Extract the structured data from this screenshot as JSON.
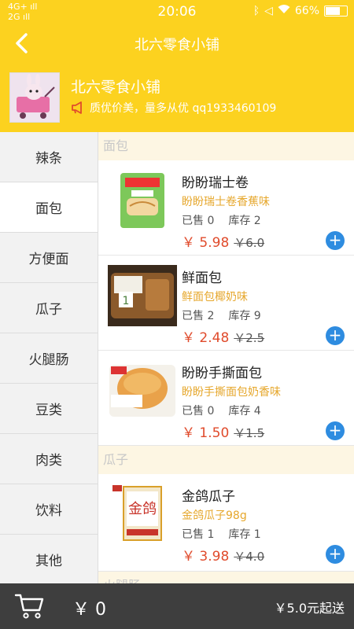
{
  "status_bar": {
    "network_1": "4G+",
    "network_2": "2G",
    "time": "20:06",
    "battery": "66%"
  },
  "header": {
    "title": "北六零食小铺",
    "back_icon": "chevron-left-icon"
  },
  "shop": {
    "name": "北六零食小铺",
    "slogan": "质优价美，量多从优 qq1933460109",
    "megaphone_icon": "megaphone-icon"
  },
  "sidebar": {
    "items": [
      {
        "label": "辣条"
      },
      {
        "label": "面包"
      },
      {
        "label": "方便面"
      },
      {
        "label": "瓜子"
      },
      {
        "label": "火腿肠"
      },
      {
        "label": "豆类"
      },
      {
        "label": "肉类"
      },
      {
        "label": "饮料"
      },
      {
        "label": "其他"
      }
    ]
  },
  "sections": [
    {
      "title": "面包",
      "products": [
        {
          "name": "盼盼瑞士卷",
          "subtitle": "盼盼瑞士卷香蕉味",
          "sold": "已售 0",
          "stock": "库存 2",
          "price": "￥ 5.98",
          "old_price": "￥6.0"
        },
        {
          "name": "鲜面包",
          "subtitle": "鲜面包椰奶味",
          "sold": "已售 2",
          "stock": "库存 9",
          "price": "￥ 2.48",
          "old_price": "￥2.5"
        },
        {
          "name": "盼盼手撕面包",
          "subtitle": "盼盼手撕面包奶香味",
          "sold": "已售 0",
          "stock": "库存 4",
          "price": "￥ 1.50",
          "old_price": "￥1.5"
        }
      ]
    },
    {
      "title": "瓜子",
      "products": [
        {
          "name": "金鸽瓜子",
          "subtitle": "金鸽瓜子98g",
          "sold": "已售 1",
          "stock": "库存 1",
          "price": "￥ 3.98",
          "old_price": "￥4.0"
        }
      ]
    },
    {
      "title": "火腿肠",
      "products": []
    }
  ],
  "cart": {
    "total": "￥ 0",
    "min_order": "￥5.0元起送",
    "cart_icon": "shopping-cart-icon"
  },
  "colors": {
    "brand": "#fcd21f",
    "price": "#e04b2c",
    "subtitle": "#e6a72c",
    "add_button": "#2e8ce0",
    "cart_bar": "#3e3e3e"
  }
}
